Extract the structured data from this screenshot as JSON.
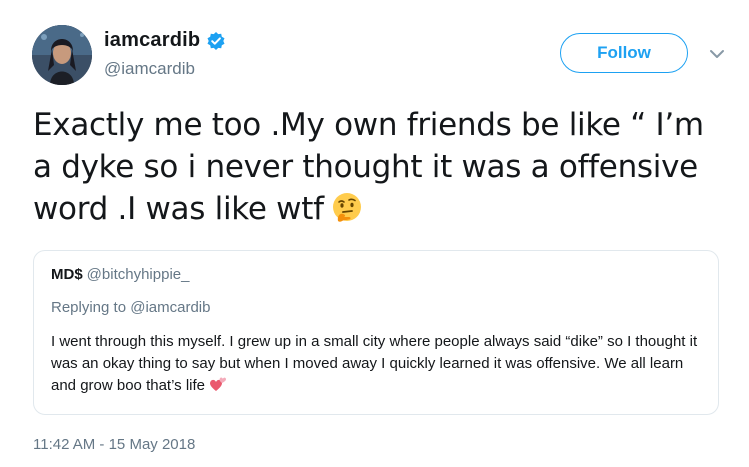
{
  "author": {
    "display_name": "iamcardib",
    "handle": "@iamcardib",
    "verified": true,
    "avatar_icon": "profile-photo"
  },
  "actions": {
    "follow_label": "Follow",
    "menu_icon": "chevron-down-icon"
  },
  "tweet": {
    "text": "Exactly me too .My own friends be like “ I’m a dyke so i never thought it was a offensive word .I was like wtf",
    "emoji": "thinking-face-icon",
    "timestamp": "11:42 AM - 15 May 2018"
  },
  "quoted_tweet": {
    "display_name": "MD$",
    "handle": "@bitchyhippie_",
    "replying_prefix": "Replying to ",
    "replying_to": "@iamcardib",
    "text": "I went through this myself. I grew up in a small city where people always said “dike” so I thought it was an okay thing to say but when I moved away I quickly learned it was offensive. We all learn and grow boo that’s life",
    "emoji": "two-hearts-icon"
  },
  "colors": {
    "accent": "#1da1f2",
    "text": "#14171a",
    "muted": "#657786",
    "border": "#e1e8ed"
  }
}
